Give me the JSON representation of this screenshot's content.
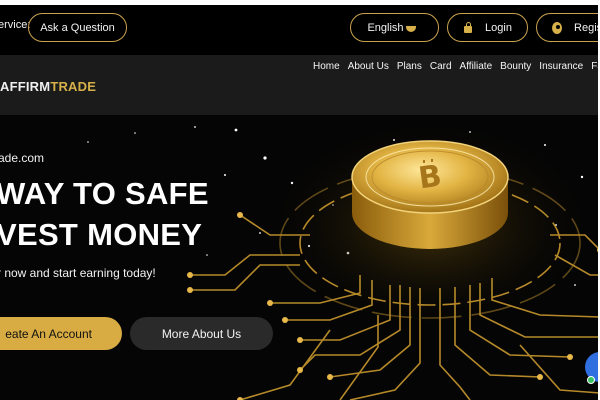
{
  "topbar": {
    "service_label": "ervice:",
    "ask_button": "Ask a Question",
    "language": "English",
    "login": "Login",
    "register": "Register"
  },
  "navbar": {
    "logo_part1": "AFFIRM",
    "logo_part2": "TRADE",
    "links": [
      "Home",
      "About Us",
      "Plans",
      "Card",
      "Affiliate",
      "Bounty",
      "Insurance",
      "Faq"
    ]
  },
  "hero": {
    "tagline": "ade.com",
    "headline_line1": "WAY TO SAFE",
    "headline_line2": "VEST MONEY",
    "subline": "r now and start earning today!",
    "primary_button": "eate An Account",
    "secondary_button": "More About Us"
  },
  "colors": {
    "accent_gold": "#d8ac42",
    "navbar_bg": "#1b1b1b",
    "page_bg": "#000000",
    "chat_widget": "#2f6fe0"
  },
  "icons": {
    "login": "lock-icon",
    "register": "user-icon",
    "language": "chevron-down-icon",
    "hero_art": "bitcoin-coin-icon",
    "chat": "chat-bubble-icon"
  }
}
